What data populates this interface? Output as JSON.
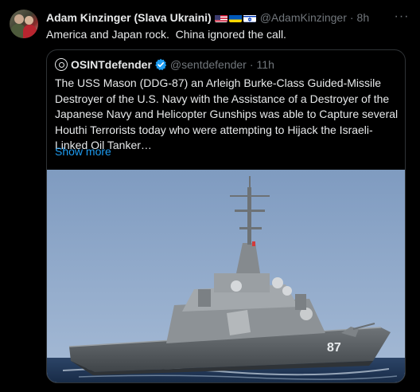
{
  "tweet": {
    "author_name": "Adam Kinzinger (Slava Ukraini)",
    "flags": [
      "us-flag",
      "ukraine-flag",
      "israel-flag"
    ],
    "handle": "@AdamKinzinger",
    "separator": "·",
    "time": "8h",
    "more_label": "···",
    "text": "America and Japan rock.  China ignored the call."
  },
  "quote": {
    "author_name": "OSINTdefender",
    "verified": true,
    "handle": "@sentdefender",
    "separator": "·",
    "time": "11h",
    "lines": [
      "The USS Mason (DDG-87) an Arleigh Burke-Class Guided-Missile",
      "Destroyer of the U.S. Navy with the Assistance of a Destroyer of the",
      "Japanese Navy and Helicopter Gunships was able to Capture several",
      "Houthi Terrorists today who were attempting to Hijack the Israeli-",
      "Linked Oil Tanker…"
    ],
    "show_more": "Show more",
    "image": {
      "subject": "navy destroyer at sea",
      "hull_number": "87"
    }
  },
  "colors": {
    "background": "#000000",
    "text": "#e7e9ea",
    "secondary": "#71767b",
    "link": "#1d9bf0",
    "border": "#2f3336"
  }
}
